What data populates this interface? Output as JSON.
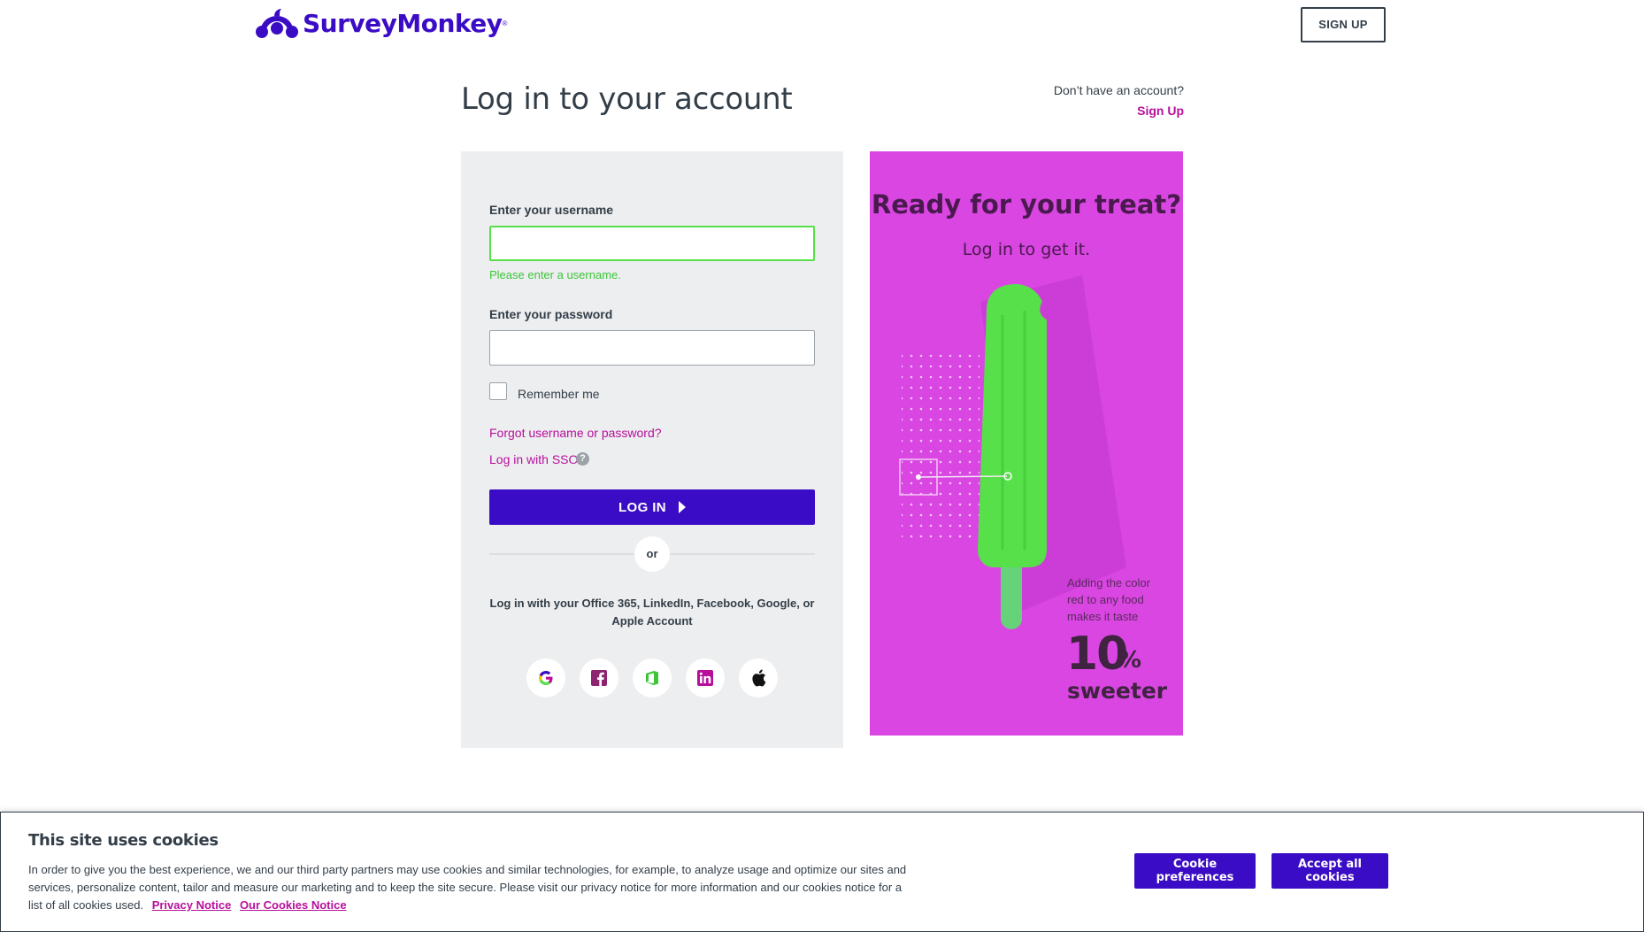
{
  "header": {
    "brand": "SurveyMonkey",
    "brand_mark": "®",
    "signup_button": "SIGN UP"
  },
  "title_row": {
    "title": "Log in to your account",
    "no_account_text": "Don’t have an account?",
    "signup_link": "Sign Up"
  },
  "login_form": {
    "username_label": "Enter your username",
    "username_value": "",
    "username_error": "Please enter a username.",
    "password_label": "Enter your password",
    "password_value": "",
    "remember_me": "Remember me",
    "forgot_link": "Forgot username or password?",
    "sso_link": "Log in with SSO",
    "help_glyph": "?",
    "login_button": "LOG IN",
    "or_text": "or",
    "social_text": "Log in with your Office 365, LinkedIn, Facebook, Google, or Apple Account",
    "social_buttons": [
      "google-icon",
      "facebook-icon",
      "office365-icon",
      "linkedin-icon",
      "apple-icon"
    ]
  },
  "promo": {
    "title": "Ready for your treat?",
    "subtitle": "Log in to get it.",
    "fact": "Adding the color red to any food makes it taste",
    "number": "10",
    "percent": "%",
    "word": "sweeter"
  },
  "cookie_banner": {
    "title": "This site uses cookies",
    "text": "In order to give you the best experience, we and our third party partners may use cookies and similar technologies, for example, to analyze usage and optimize our sites and services, personalize content, tailor and measure our marketing and to keep the site secure. Please visit our privacy notice for more information and our cookies notice for a list of all cookies used.",
    "privacy_link": "Privacy Notice",
    "cookies_link": "Our Cookies Notice",
    "preferences_button": "Cookie preferences",
    "accept_button": "Accept all cookies"
  },
  "colors": {
    "brand": "#3b0cc5",
    "link": "#b70f9b",
    "error": "#3dc53a",
    "promo_bg": "#d946e2",
    "popsicle": "#57e049"
  }
}
